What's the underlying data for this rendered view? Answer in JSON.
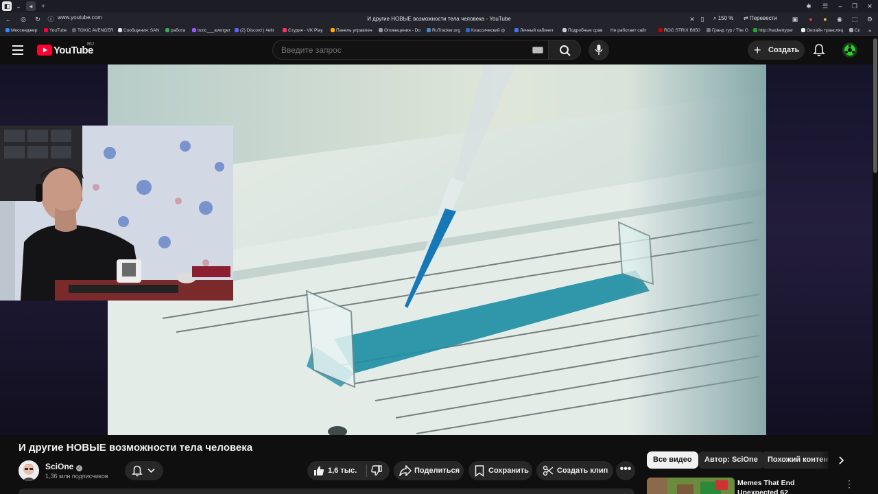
{
  "browser": {
    "url": "www.youtube.com",
    "doc_title": "И другие НОВЫЕ возможности тела человека - YouTube",
    "zoom": "150 %",
    "translate_label": "Перевести",
    "bookmarks": [
      {
        "label": "Мессенджер",
        "color": "#2d88ff"
      },
      {
        "label": "YouTube",
        "color": "#ff0033"
      },
      {
        "label": "TOXIC AVENGER",
        "color": "#444444"
      },
      {
        "label": "Сообщения: SAN",
        "color": "#dddddd"
      },
      {
        "label": "работа",
        "color": "#33aa55"
      },
      {
        "label": "toxic___avenger",
        "color": "#9955ff"
      },
      {
        "label": "(2) Discord | #eltr",
        "color": "#5865f2"
      },
      {
        "label": "Студия - VK Play",
        "color": "#ff3366"
      },
      {
        "label": "Панель управлен",
        "color": "#ffaa00"
      },
      {
        "label": "Оповещения - Do",
        "color": "#999999"
      },
      {
        "label": "RuTracker.org",
        "color": "#4488cc"
      },
      {
        "label": "Классический ф",
        "color": "#3366cc"
      },
      {
        "label": "Личный кабинет",
        "color": "#4477ee"
      },
      {
        "label": "Подробные срав",
        "color": "#cccccc"
      },
      {
        "label": "Не работает сайт",
        "color": "#23232c"
      },
      {
        "label": "ROG STRIX B650",
        "color": "#cc0000"
      },
      {
        "label": "Гранд тур / The G",
        "color": "#777777"
      },
      {
        "label": "http://hackertyper",
        "color": "#22aa22"
      },
      {
        "label": "Онлайн трансляц",
        "color": "#eeeeee"
      },
      {
        "label": "Ск",
        "color": "#aaaaaa"
      }
    ]
  },
  "header": {
    "logo_text": "YouTube",
    "region": "RU",
    "search_placeholder": "Введите запрос",
    "create_label": "Создать"
  },
  "video": {
    "title": "И другие НОВЫЕ возможности тела человека"
  },
  "channel": {
    "name": "SciOne",
    "subscribers": "1,36 млн подписчиков"
  },
  "actions": {
    "likes": "1,6 тыс.",
    "share": "Поделиться",
    "save": "Сохранить",
    "clip": "Создать клип"
  },
  "chips": [
    "Все видео",
    "Автор: SciOne",
    "Похожий контент"
  ],
  "recommended": [
    {
      "title": "Memes That End Unexpected 62"
    }
  ],
  "colors": {
    "accent_red": "#ff0033",
    "background": "#0f0f0f",
    "button_bg": "#272727"
  }
}
